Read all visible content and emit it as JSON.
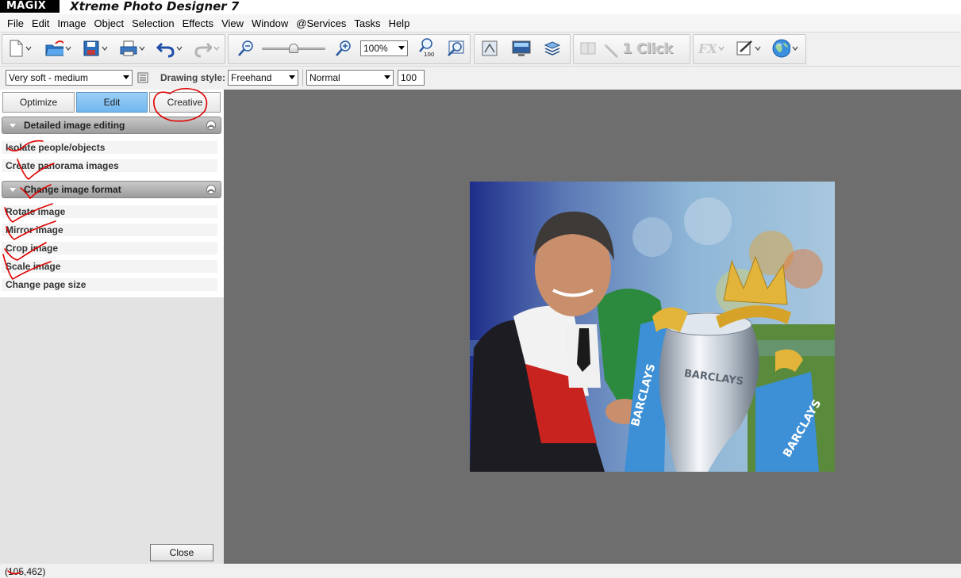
{
  "window": {
    "brand": "MAGIX",
    "title": "Xtreme Photo Designer 7"
  },
  "menu": [
    "File",
    "Edit",
    "Image",
    "Object",
    "Selection",
    "Effects",
    "View",
    "Window",
    "@Services",
    "Tasks",
    "Help"
  ],
  "toolbar": {
    "zoom_value": "100%",
    "one_click_label": "1 Click",
    "zoom_100_badge": "100"
  },
  "options": {
    "brush_preset": "Very soft - medium",
    "drawing_style_label": "Drawing style:",
    "drawing_style": "Freehand",
    "blend_mode": "Normal",
    "opacity": "100"
  },
  "panel": {
    "tabs": [
      {
        "label": "Optimize",
        "active": false
      },
      {
        "label": "Edit",
        "active": true
      },
      {
        "label": "Creative",
        "active": false
      }
    ],
    "sections": [
      {
        "title": "Detailed image editing",
        "items": [
          "Isolate people/objects",
          "Create panorama images"
        ]
      },
      {
        "title": "Change image format",
        "items": [
          "Rotate image",
          "Mirror image",
          "Crop image",
          "Scale image",
          "Change page size"
        ]
      }
    ],
    "close_label": "Close"
  },
  "photo": {
    "banner_text": "BARCLAYS"
  },
  "status": {
    "cursor_position": "(105,462)"
  },
  "colors": {
    "canvas_bg": "#6e6e6e",
    "active_tab": "#7fbff0",
    "annotation_ink": "#e00000",
    "photo_sky": "#2a3a8a",
    "trophy_ribbon": "#3d8fd6"
  }
}
